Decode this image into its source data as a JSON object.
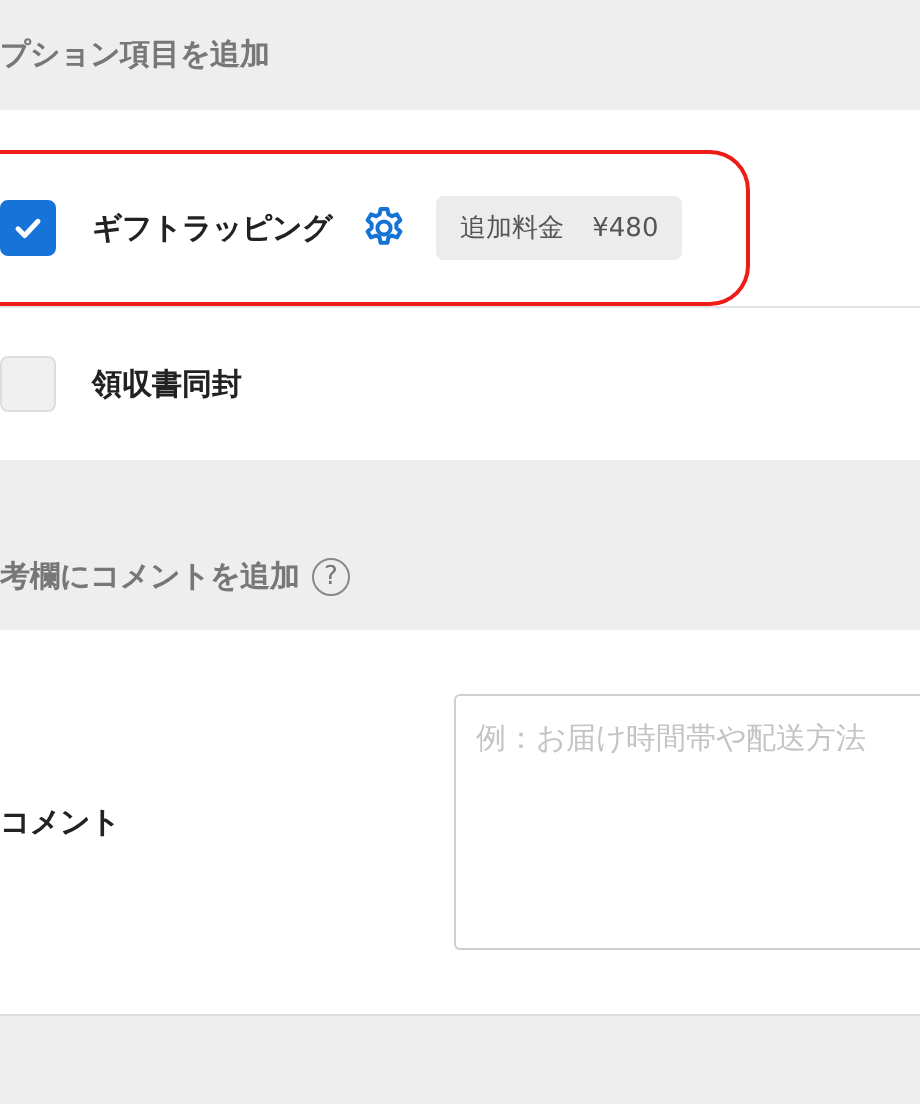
{
  "sections": [
    {
      "kind": "options",
      "heading": "プション項目を追加",
      "options": [
        {
          "label": "ギフトラッピング",
          "checked": true,
          "highlighted": true,
          "settings": true,
          "badge": "追加料金 ¥480"
        },
        {
          "label": "領収書同封",
          "checked": false,
          "highlighted": false,
          "settings": false
        }
      ]
    },
    {
      "kind": "comment",
      "heading": "考欄にコメントを追加",
      "help": "?",
      "label": "コメント",
      "placeholder": "例：お届け時間帯や配送方法"
    }
  ]
}
